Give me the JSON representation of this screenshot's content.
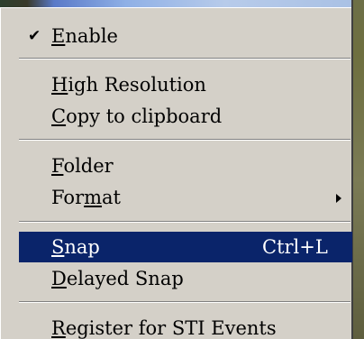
{
  "menu": {
    "enable": {
      "checked": true,
      "before": "",
      "mnemonic": "E",
      "after": "nable"
    },
    "high_resolution": {
      "before": "",
      "mnemonic": "H",
      "after": "igh Resolution"
    },
    "copy_to_clipboard": {
      "before": "",
      "mnemonic": "C",
      "after": "opy to clipboard"
    },
    "folder": {
      "before": "",
      "mnemonic": "F",
      "after": "older"
    },
    "format": {
      "before": "For",
      "mnemonic": "m",
      "after": "at",
      "has_submenu": true
    },
    "snap": {
      "before": "",
      "mnemonic": "S",
      "after": "nap",
      "shortcut": "Ctrl+L",
      "selected": true
    },
    "delayed_snap": {
      "before": "",
      "mnemonic": "D",
      "after": "elayed Snap"
    },
    "register_sti": {
      "before": "",
      "mnemonic": "R",
      "after": "egister for STI Events"
    }
  },
  "colors": {
    "menu_background": "#d4d0c8",
    "highlight": "#0a246a",
    "highlight_text": "#ffffff"
  },
  "icons": {
    "check": "✔"
  }
}
